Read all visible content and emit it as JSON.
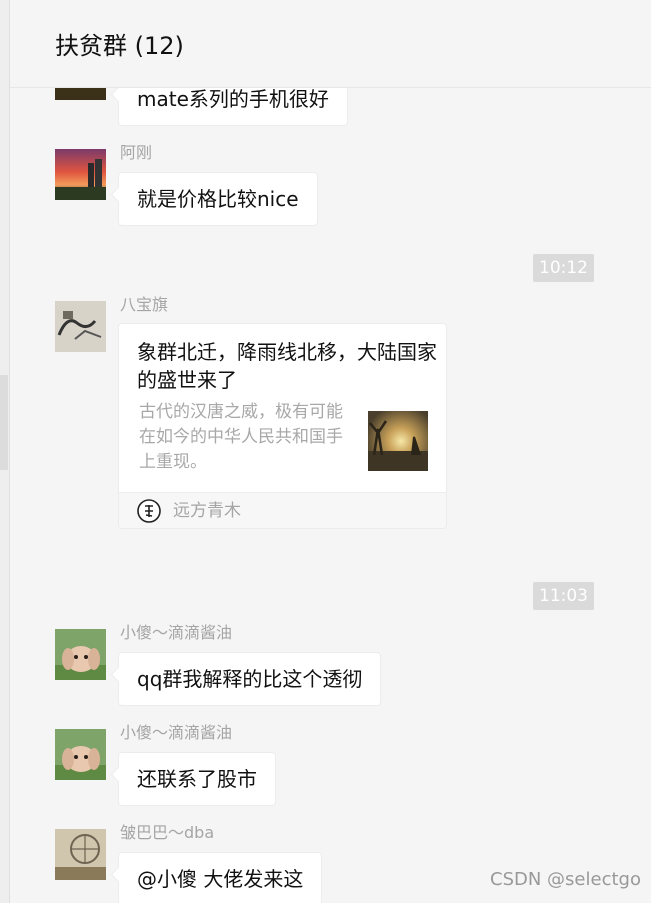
{
  "header": {
    "title": "扶贫群 (12)"
  },
  "messages": [
    {
      "text": "mate系列的手机很好"
    },
    {
      "sender": "阿刚",
      "text": "就是价格比较nice"
    },
    {
      "sender": "八宝旗"
    },
    {
      "sender": "小傻～滴滴酱油",
      "text": "qq群我解释的比这个透彻"
    },
    {
      "sender": "小傻～滴滴酱油",
      "text": "还联系了股市"
    },
    {
      "sender": "皱巴巴～dba",
      "text": "@小傻 大佬发来这"
    }
  ],
  "times": [
    "10:12",
    "11:03"
  ],
  "card": {
    "title": "象群北迁，降雨线北移，大陆国家的盛世来了",
    "desc": "古代的汉唐之威，极有可能在如今的中华人民共和国手上重现。",
    "source": "远方青木"
  },
  "watermark": "CSDN @selectgo"
}
